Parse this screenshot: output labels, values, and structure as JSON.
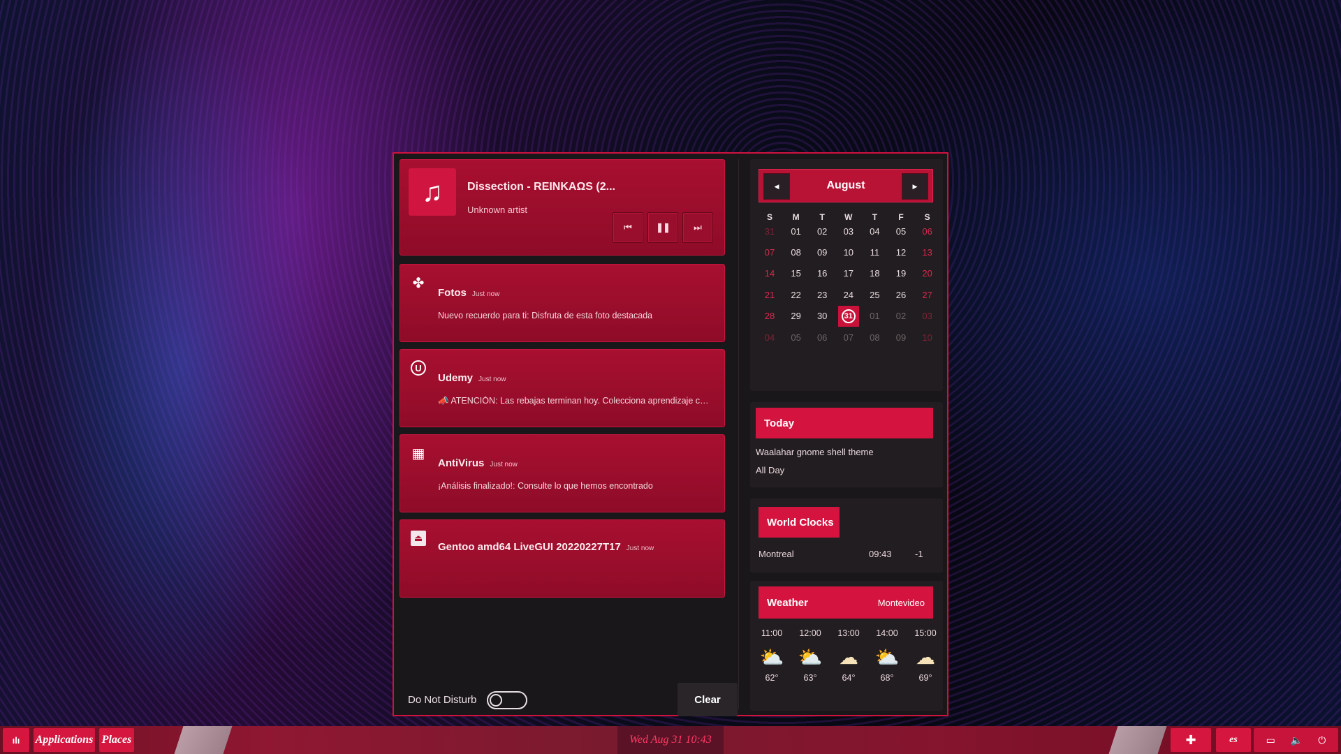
{
  "media": {
    "title": "Dissection - REINKAΩS (2...",
    "artist": "Unknown artist",
    "icon": "music-note-icon",
    "controls": [
      "previous-icon",
      "pause-icon",
      "next-icon"
    ]
  },
  "notifications": [
    {
      "app": "Fotos",
      "time": "Just now",
      "body": "Nuevo recuerdo para ti: Disfruta de esta foto destacada",
      "icon": "pinwheel-icon"
    },
    {
      "app": "Udemy",
      "time": "Just now",
      "body": "📣 ATENCIÓN: Las rebajas terminan hoy. Colecciona aprendizaje con...",
      "icon": "udemy-icon"
    },
    {
      "app": "AntiVirus",
      "time": "Just now",
      "body": "¡Análisis finalizado!: Consulte lo que hemos encontrado",
      "icon": "antivirus-icon"
    },
    {
      "app": "Gentoo amd64 LiveGUI 20220227T17",
      "time": "Just now",
      "body": "",
      "icon": "eject-icon"
    }
  ],
  "dnd": {
    "label": "Do Not Disturb",
    "enabled": false
  },
  "clear_label": "Clear",
  "calendar": {
    "month": "August",
    "days_of_week": [
      "S",
      "M",
      "T",
      "W",
      "T",
      "F",
      "S"
    ],
    "weeks": [
      [
        "31",
        "01",
        "02",
        "03",
        "04",
        "05",
        "06"
      ],
      [
        "07",
        "08",
        "09",
        "10",
        "11",
        "12",
        "13"
      ],
      [
        "14",
        "15",
        "16",
        "17",
        "18",
        "19",
        "20"
      ],
      [
        "21",
        "22",
        "23",
        "24",
        "25",
        "26",
        "27"
      ],
      [
        "28",
        "29",
        "30",
        "31",
        "01",
        "02",
        "03"
      ],
      [
        "04",
        "05",
        "06",
        "07",
        "08",
        "09",
        "10"
      ]
    ],
    "today": "31"
  },
  "events": {
    "heading": "Today",
    "title": "Waalahar gnome shell theme",
    "time": "All Day"
  },
  "world_clocks": {
    "heading": "World Clocks",
    "city": "Montreal",
    "time": "09:43",
    "offset": "-1"
  },
  "weather": {
    "heading": "Weather",
    "location": "Montevideo",
    "forecast": [
      {
        "time": "11:00",
        "temp": "62°",
        "icon": "partly-cloudy-icon"
      },
      {
        "time": "12:00",
        "temp": "63°",
        "icon": "partly-cloudy-icon"
      },
      {
        "time": "13:00",
        "temp": "64°",
        "icon": "cloudy-icon"
      },
      {
        "time": "14:00",
        "temp": "68°",
        "icon": "partly-cloudy-icon"
      },
      {
        "time": "15:00",
        "temp": "69°",
        "icon": "cloudy-icon"
      }
    ]
  },
  "taskbar": {
    "applications": "Applications",
    "places": "Places",
    "clock": "Wed Aug 31  10:43",
    "keyboard": "es"
  },
  "colors": {
    "accent": "#d4143f",
    "card": "#a80f30",
    "popup_bg": "#1a171a"
  }
}
